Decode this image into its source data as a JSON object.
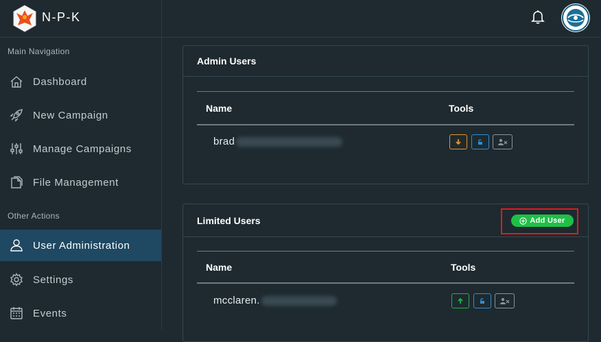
{
  "brand": {
    "name": "N-P-K"
  },
  "sidebar": {
    "sections": [
      {
        "label": "Main Navigation"
      },
      {
        "label": "Other Actions"
      }
    ],
    "items": [
      {
        "label": "Dashboard",
        "icon": "home-icon"
      },
      {
        "label": "New Campaign",
        "icon": "rocket-icon"
      },
      {
        "label": "Manage Campaigns",
        "icon": "sliders-icon"
      },
      {
        "label": "File Management",
        "icon": "files-icon"
      },
      {
        "label": "User Administration",
        "icon": "user-icon",
        "active": true
      },
      {
        "label": "Settings",
        "icon": "gear-icon"
      },
      {
        "label": "Events",
        "icon": "calendar-icon"
      }
    ]
  },
  "admin_users": {
    "title": "Admin Users",
    "columns": [
      "Name",
      "Tools"
    ],
    "rows": [
      {
        "name": "brad"
      }
    ]
  },
  "limited_users": {
    "title": "Limited Users",
    "add_label": "Add User",
    "columns": [
      "Name",
      "Tools"
    ],
    "rows": [
      {
        "name": "mcclaren."
      }
    ]
  },
  "colors": {
    "active_nav": "#1f4863",
    "add_button": "#1ec046",
    "highlight": "#e01b1b",
    "demote": "#e6952b",
    "promote": "#25b14a",
    "unlock": "#2f8ed3"
  }
}
